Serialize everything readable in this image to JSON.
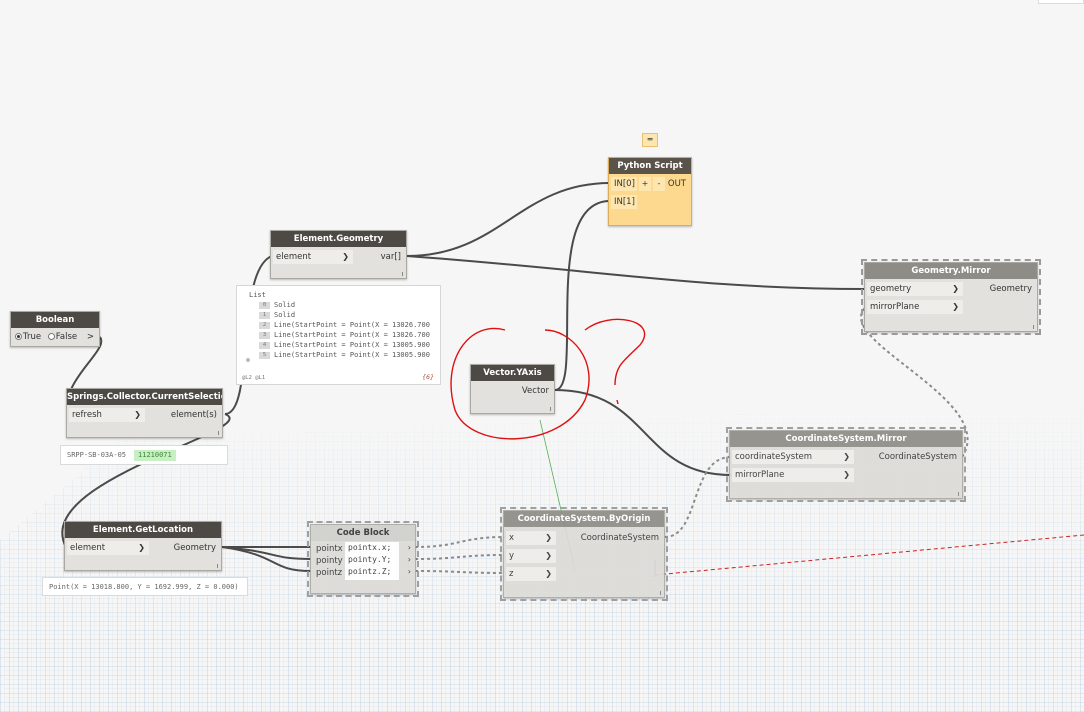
{
  "nodes": {
    "boolean": {
      "title": "Boolean",
      "option_true": "True",
      "option_false": "False",
      "out": ">"
    },
    "current_selection": {
      "title": "Springs.Collector.CurrentSelection",
      "in_refresh": "refresh",
      "out_elements": "element(s)",
      "preview_name": "SRPP-SB-03A-05",
      "preview_id": "11210071"
    },
    "element_geometry": {
      "title": "Element.Geometry",
      "in_element": "element",
      "out_var": "var[]",
      "list_header": "List",
      "rows": [
        {
          "index": "0",
          "text": "Solid"
        },
        {
          "index": "1",
          "text": "Solid"
        },
        {
          "index": "2",
          "text": "Line(StartPoint = Point(X = 13026.700"
        },
        {
          "index": "3",
          "text": "Line(StartPoint = Point(X = 13026.700"
        },
        {
          "index": "4",
          "text": "Line(StartPoint = Point(X = 13005.900"
        },
        {
          "index": "5",
          "text": "Line(StartPoint = Point(X = 13005.900"
        }
      ],
      "list_levels": "@L2 @L1",
      "list_count": "{6}"
    },
    "element_getlocation": {
      "title": "Element.GetLocation",
      "in_element": "element",
      "out_geometry": "Geometry",
      "preview": "Point(X = 13018.800, Y = 1692.999, Z = 0.000)"
    },
    "code_block": {
      "title": "Code Block",
      "lines": [
        "pointx.x;",
        "pointy.Y;",
        "pointz.Z;"
      ],
      "outputs": [
        "pointx",
        "pointy",
        "pointz"
      ]
    },
    "coordsys_byorigin": {
      "title": "CoordinateSystem.ByOrigin",
      "in_x": "x",
      "in_y": "y",
      "in_z": "z",
      "out": "CoordinateSystem"
    },
    "vector_yaxis": {
      "title": "Vector.YAxis",
      "out": "Vector"
    },
    "python_script": {
      "title": "Python Script",
      "in0": "IN[0]",
      "in1": "IN[1]",
      "plus": "+",
      "minus": "-",
      "out": "OUT"
    },
    "geometry_mirror": {
      "title": "Geometry.Mirror",
      "in_geometry": "geometry",
      "in_mirror": "mirrorPlane",
      "out": "Geometry"
    },
    "coordsys_mirror": {
      "title": "CoordinateSystem.Mirror",
      "in_cs": "coordinateSystem",
      "in_mirror": "mirrorPlane",
      "out": "CoordinateSystem"
    }
  },
  "colors": {
    "node_title": "#4d4a46",
    "node_body": "#e2e1dd",
    "python_body": "#fcd98f",
    "wire": "#4a4a4a",
    "annotation": "#e01010",
    "grid": "#7fa6c9",
    "axis_x": "#d02020",
    "axis_y": "#30a030",
    "preview_chip": "#c8efc3"
  },
  "icons": {
    "python_note": "speech-note-icon"
  }
}
